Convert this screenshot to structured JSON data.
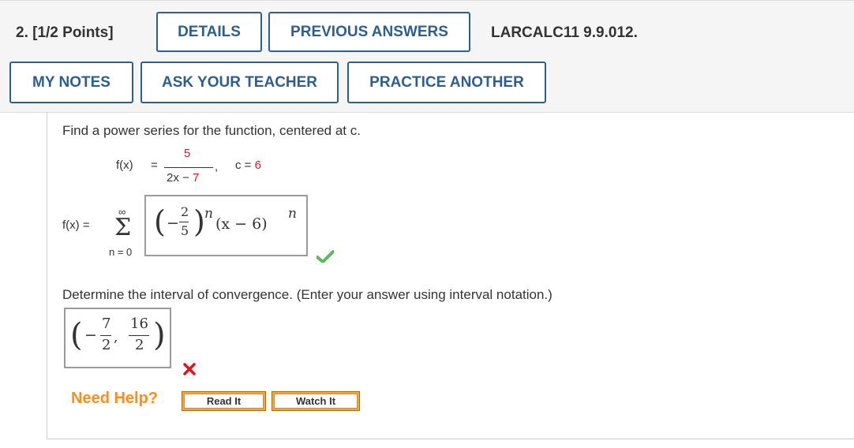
{
  "header": {
    "question_label": "2. [1/2 Points]",
    "details_label": "DETAILS",
    "previous_answers_label": "PREVIOUS ANSWERS",
    "problem_code": "LARCALC11 9.9.012.",
    "my_notes_label": "MY NOTES",
    "ask_teacher_label": "ASK YOUR TEACHER",
    "practice_another_label": "PRACTICE ANOTHER"
  },
  "problem": {
    "instruction": "Find a power series for the function, centered at c.",
    "function_lhs": "f(x)",
    "equals": "=",
    "numerator": "5",
    "denominator_prefix": "2x − ",
    "denominator_value": "7",
    "comma": ",",
    "center_label": "c = ",
    "center_value": "6"
  },
  "answer1": {
    "lhs": "f(x) =",
    "sum_upper": "∞",
    "sum_symbol": "Σ",
    "sum_lower": "n = 0",
    "open_paren": "(",
    "minus": "−",
    "frac_num": "2",
    "frac_den": "5",
    "close_paren": ")",
    "power": "n",
    "factor": "(x − 6)",
    "factor_power": "n",
    "status_icon": "checkmark-icon",
    "status_color": "#5cb85c"
  },
  "interval": {
    "instruction": "Determine the interval of convergence. (Enter your answer using interval notation.)",
    "open_paren": "(",
    "minus": "−",
    "left_num": "7",
    "left_den": "2",
    "separator": ",",
    "right_num": "16",
    "right_den": "2",
    "close_paren": ")",
    "status_icon": "cross-icon",
    "status_color": "#e0141e"
  },
  "help": {
    "label": "Need Help?",
    "read_it": "Read It",
    "watch_it": "Watch It"
  }
}
